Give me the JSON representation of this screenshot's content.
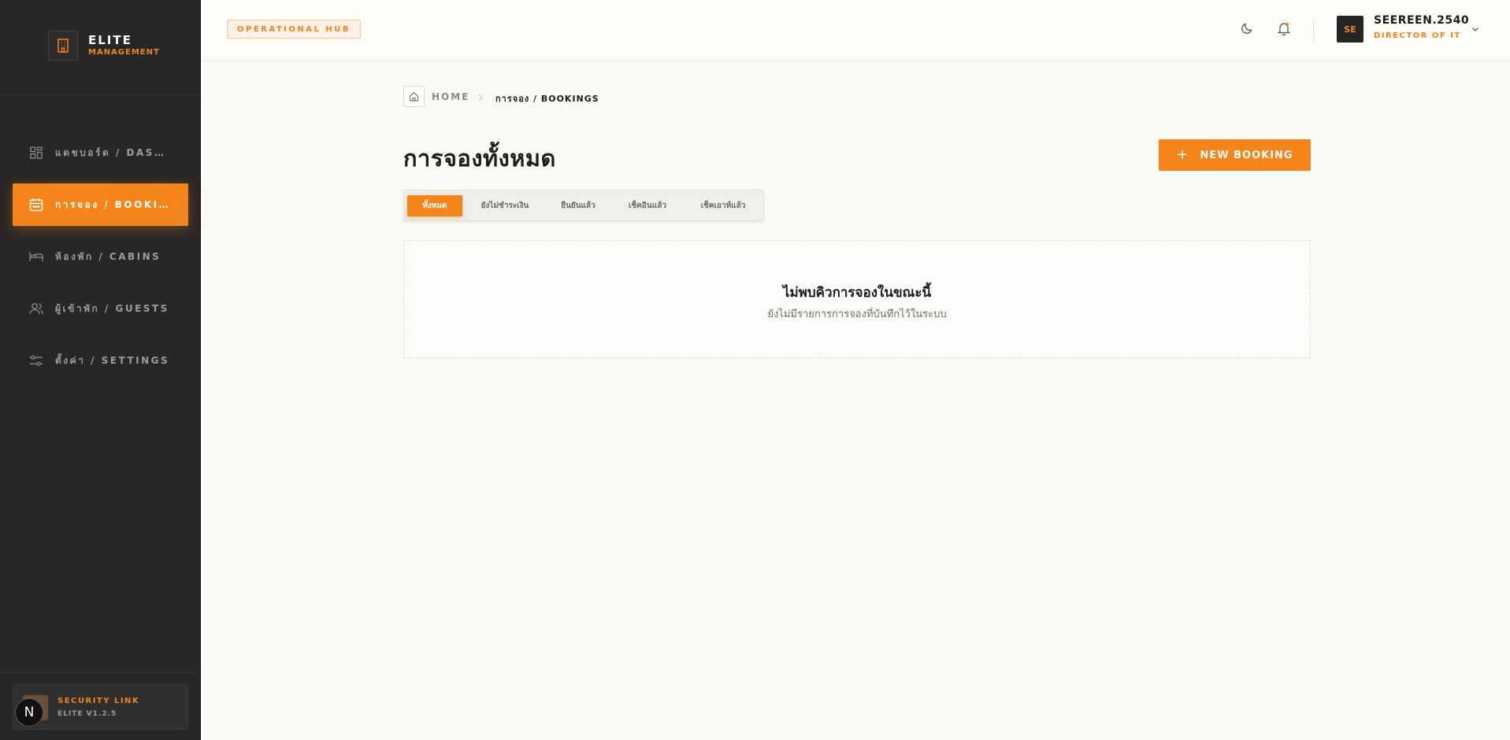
{
  "brand": {
    "name": "ELITE",
    "subtitle": "MANAGEMENT"
  },
  "sidebar": {
    "items": [
      {
        "label": "แดชบอร์ด / DASHBOARD",
        "icon": "dashboard-grid-icon",
        "active": false
      },
      {
        "label": "การจอง / BOOKINGS",
        "icon": "calendar-icon",
        "active": true
      },
      {
        "label": "ห้องพัก / CABINS",
        "icon": "bed-icon",
        "active": false
      },
      {
        "label": "ผู้เข้าพัก / GUESTS",
        "icon": "users-icon",
        "active": false
      },
      {
        "label": "ตั้งค่า / SETTINGS",
        "icon": "sliders-icon",
        "active": false
      }
    ],
    "security": {
      "title": "SECURITY LINK",
      "version": "ELITE V1.2.5"
    },
    "badge": "N"
  },
  "header": {
    "hub_label": "OPERATIONAL HUB",
    "user": {
      "initials": "SE",
      "name": "SEEREEN.2540",
      "role": "DIRECTOR OF IT"
    },
    "icons": [
      "moon-icon",
      "bell-icon",
      "chevron-down-icon"
    ]
  },
  "breadcrumb": {
    "home": "HOME",
    "current": "การจอง / BOOKINGS"
  },
  "main": {
    "title": "การจองทั้งหมด",
    "new_button": "NEW BOOKING",
    "tabs": [
      {
        "label": "ทั้งหมด",
        "active": true
      },
      {
        "label": "ยังไม่ชำระเงิน",
        "active": false
      },
      {
        "label": "ยืนยันแล้ว",
        "active": false
      },
      {
        "label": "เช็คอินแล้ว",
        "active": false
      },
      {
        "label": "เช็คเอาท์แล้ว",
        "active": false
      }
    ],
    "empty": {
      "title": "ไม่พบคิวการจองในขณะนี้",
      "subtitle": "ยังไม่มีรายการการจองที่บันทึกไว้ในระบบ"
    }
  },
  "colors": {
    "accent": "#f5841a",
    "sidebar_bg": "#272727",
    "page_bg": "#f9f9f6"
  }
}
